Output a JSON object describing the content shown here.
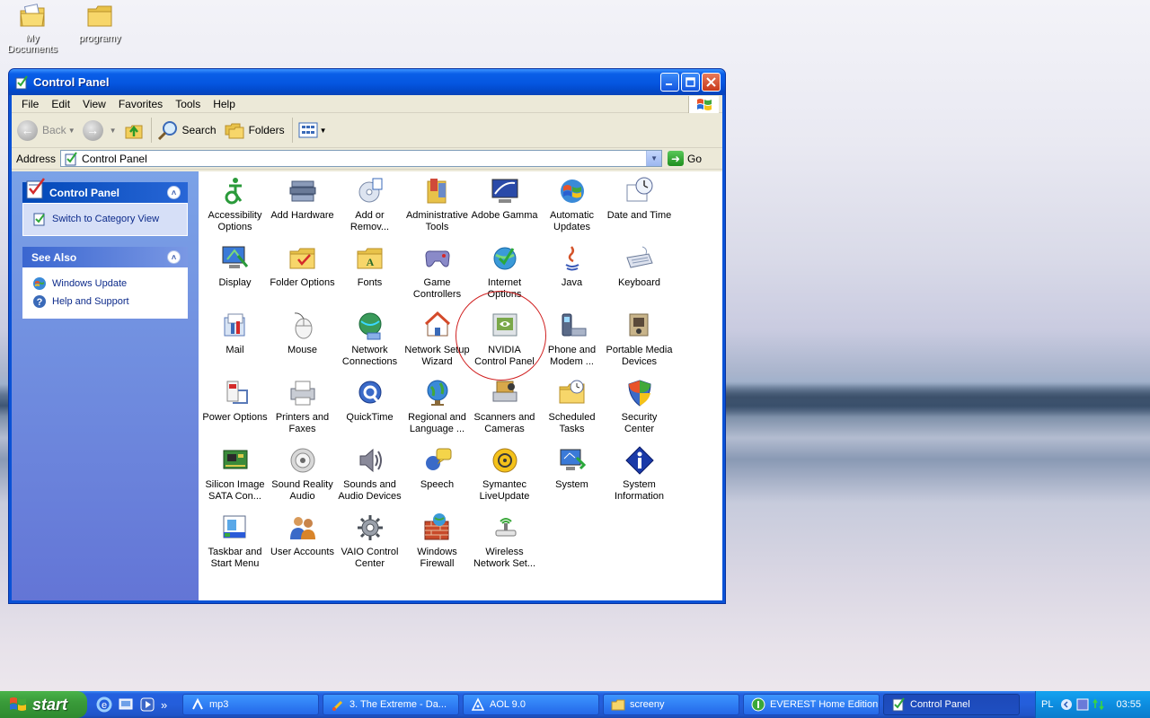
{
  "desktop": {
    "icons": [
      {
        "label": "My Documents"
      },
      {
        "label": "programy"
      }
    ]
  },
  "window": {
    "title": "Control Panel",
    "menu": [
      "File",
      "Edit",
      "View",
      "Favorites",
      "Tools",
      "Help"
    ],
    "toolbar": {
      "back": "Back",
      "search": "Search",
      "folders": "Folders"
    },
    "address": {
      "label": "Address",
      "value": "Control Panel",
      "go": "Go"
    }
  },
  "sidebar": {
    "control_panel": {
      "title": "Control Panel",
      "items": [
        "Switch to Category View"
      ]
    },
    "see_also": {
      "title": "See Also",
      "items": [
        "Windows Update",
        "Help and Support"
      ]
    }
  },
  "items": [
    {
      "l1": "Accessibility",
      "l2": "Options",
      "icon": "accessibility-icon"
    },
    {
      "l1": "Add Hardware",
      "l2": "",
      "icon": "add-hardware-icon"
    },
    {
      "l1": "Add or",
      "l2": "Remov...",
      "icon": "add-remove-programs-icon"
    },
    {
      "l1": "Administrative",
      "l2": "Tools",
      "icon": "administrative-tools-icon"
    },
    {
      "l1": "Adobe Gamma",
      "l2": "",
      "icon": "adobe-gamma-icon"
    },
    {
      "l1": "Automatic",
      "l2": "Updates",
      "icon": "automatic-updates-icon"
    },
    {
      "l1": "Date and Time",
      "l2": "",
      "icon": "date-time-icon"
    },
    {
      "l1": "Display",
      "l2": "",
      "icon": "display-icon"
    },
    {
      "l1": "Folder Options",
      "l2": "",
      "icon": "folder-options-icon"
    },
    {
      "l1": "Fonts",
      "l2": "",
      "icon": "fonts-icon"
    },
    {
      "l1": "Game",
      "l2": "Controllers",
      "icon": "game-controllers-icon"
    },
    {
      "l1": "Internet",
      "l2": "Options",
      "icon": "internet-options-icon"
    },
    {
      "l1": "Java",
      "l2": "",
      "icon": "java-icon"
    },
    {
      "l1": "Keyboard",
      "l2": "",
      "icon": "keyboard-icon"
    },
    {
      "l1": "Mail",
      "l2": "",
      "icon": "mail-icon"
    },
    {
      "l1": "Mouse",
      "l2": "",
      "icon": "mouse-icon"
    },
    {
      "l1": "Network",
      "l2": "Connections",
      "icon": "network-connections-icon"
    },
    {
      "l1": "Network Setup",
      "l2": "Wizard",
      "icon": "network-setup-icon"
    },
    {
      "l1": "NVIDIA",
      "l2": "Control Panel",
      "icon": "nvidia-icon"
    },
    {
      "l1": "Phone and",
      "l2": "Modem ...",
      "icon": "phone-modem-icon"
    },
    {
      "l1": "Portable Media",
      "l2": "Devices",
      "icon": "portable-media-icon"
    },
    {
      "l1": "Power Options",
      "l2": "",
      "icon": "power-options-icon"
    },
    {
      "l1": "Printers and",
      "l2": "Faxes",
      "icon": "printers-icon"
    },
    {
      "l1": "QuickTime",
      "l2": "",
      "icon": "quicktime-icon"
    },
    {
      "l1": "Regional and",
      "l2": "Language ...",
      "icon": "regional-icon"
    },
    {
      "l1": "Scanners and",
      "l2": "Cameras",
      "icon": "scanners-icon"
    },
    {
      "l1": "Scheduled",
      "l2": "Tasks",
      "icon": "scheduled-tasks-icon"
    },
    {
      "l1": "Security",
      "l2": "Center",
      "icon": "security-center-icon"
    },
    {
      "l1": "Silicon Image",
      "l2": "SATA Con...",
      "icon": "sata-icon"
    },
    {
      "l1": "Sound Reality",
      "l2": "Audio",
      "icon": "sound-reality-icon"
    },
    {
      "l1": "Sounds and",
      "l2": "Audio Devices",
      "icon": "sounds-icon"
    },
    {
      "l1": "Speech",
      "l2": "",
      "icon": "speech-icon"
    },
    {
      "l1": "Symantec",
      "l2": "LiveUpdate",
      "icon": "symantec-icon"
    },
    {
      "l1": "System",
      "l2": "",
      "icon": "system-icon"
    },
    {
      "l1": "System",
      "l2": "Information",
      "icon": "system-information-icon"
    },
    {
      "l1": "Taskbar and",
      "l2": "Start Menu",
      "icon": "taskbar-icon"
    },
    {
      "l1": "User Accounts",
      "l2": "",
      "icon": "user-accounts-icon"
    },
    {
      "l1": "VAIO Control",
      "l2": "Center",
      "icon": "vaio-icon"
    },
    {
      "l1": "Windows",
      "l2": "Firewall",
      "icon": "firewall-icon"
    },
    {
      "l1": "Wireless",
      "l2": "Network Set...",
      "icon": "wireless-icon"
    }
  ],
  "taskbar": {
    "start": "start",
    "buttons": [
      {
        "label": "mp3",
        "icon": "winamp-icon"
      },
      {
        "label": "3. The Extreme - Da...",
        "icon": "music-icon"
      },
      {
        "label": "AOL 9.0",
        "icon": "aol-icon"
      },
      {
        "label": "screeny",
        "icon": "folder-icon"
      },
      {
        "label": "EVEREST Home Edition",
        "icon": "everest-icon"
      },
      {
        "label": "Control Panel",
        "icon": "control-panel-icon",
        "active": true
      }
    ],
    "tray": {
      "lang": "PL",
      "clock": "03:55"
    }
  }
}
